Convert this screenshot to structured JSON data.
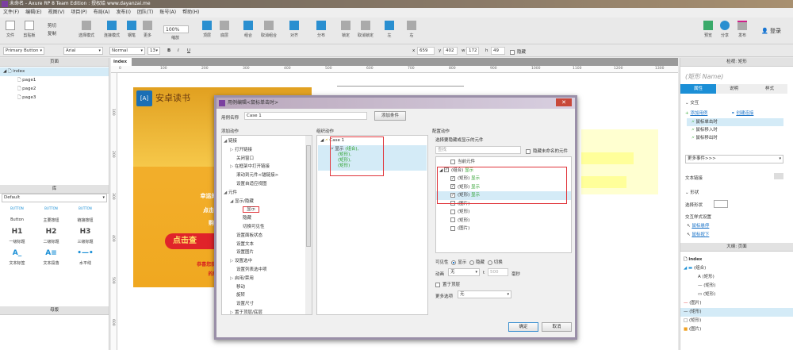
{
  "window": {
    "title": "未命名 - Axure RP 8 Team Edition : 授权给 www.dayanzai.me"
  },
  "menu": [
    "文件(F)",
    "编辑(E)",
    "视图(V)",
    "项目(P)",
    "布局(A)",
    "发布(I)",
    "团队(T)",
    "账号(A)",
    "帮助(H)"
  ],
  "toolbar": {
    "file": "文件",
    "clipboard": "剪贴板",
    "cut": "剪切",
    "copy": "复制",
    "select_mode": "选择模式",
    "connect": "连接模式",
    "pen": "钢笔",
    "more": "更多",
    "zoom": "100%",
    "zoom_label": "缩放",
    "top": "顶层",
    "bottom": "底层",
    "group": "组合",
    "ungroup": "取消组合",
    "align": "对齐",
    "distribute": "分布",
    "lock": "锁定",
    "unlock": "取消锁定",
    "left": "左",
    "right": "右",
    "preview": "预览",
    "share": "分享",
    "publish": "发布",
    "login": "登录"
  },
  "format": {
    "style": "Primary Button",
    "font": "Arial",
    "weight": "Normal",
    "size": "13",
    "bold": "B",
    "italic": "I",
    "underline": "U",
    "x_label": "x",
    "x": "659",
    "y_label": "y",
    "y": "402",
    "w_label": "w",
    "w": "172",
    "h_label": "h",
    "h": "49",
    "hidden": "隐藏"
  },
  "pages": {
    "title": "页面",
    "items": [
      "index",
      "page1",
      "page2",
      "page3"
    ]
  },
  "library": {
    "title": "库",
    "selected": "Default",
    "widgets": [
      {
        "icon": "BUTTON",
        "label": "Button"
      },
      {
        "icon": "BUTTON",
        "label": "主要按钮"
      },
      {
        "icon": "BUTTON",
        "label": "链接按钮"
      },
      {
        "icon": "H1",
        "label": "一级标题"
      },
      {
        "icon": "H2",
        "label": "二级标题"
      },
      {
        "icon": "H3",
        "label": "三级标题"
      },
      {
        "icon": "A_",
        "label": "文本标签"
      },
      {
        "icon": "A≡",
        "label": "文本段落"
      },
      {
        "icon": "•—•",
        "label": "水平线"
      }
    ]
  },
  "masters": {
    "title": "母版"
  },
  "canvas": {
    "tab": "index",
    "hticks": [
      "0",
      "100",
      "200",
      "300",
      "400",
      "500",
      "600",
      "700",
      "800",
      "900",
      "1000",
      "1100",
      "1200",
      "1300"
    ],
    "vticks": [
      "100",
      "200",
      "300",
      "400",
      "500",
      "600"
    ],
    "banner": {
      "logo": "[A]",
      "title": "安卓读书",
      "line1": "幸运的书友你好，",
      "line2": "点击有机会获得",
      "line3": "购买以下书",
      "button": "点击查",
      "red1": "恭喜您获得X元优惠，您",
      "red2": "的所有章节（"
    }
  },
  "dialog": {
    "title": "用例编辑<鼠标单击时>",
    "case_label": "用例名称",
    "case_value": "Case 1",
    "add_condition": "添加条件",
    "add_action": "添加动作",
    "organize": "组织动作",
    "configure": "配置动作",
    "actions": [
      {
        "t": "链接",
        "l": 0,
        "a": "◢"
      },
      {
        "t": "打开链接",
        "l": 1,
        "a": "▷"
      },
      {
        "t": "关闭窗口",
        "l": 1
      },
      {
        "t": "在框架中打开链接",
        "l": 1,
        "a": "▷"
      },
      {
        "t": "滚动到元件<锚链接>",
        "l": 1
      },
      {
        "t": "设置自适应视图",
        "l": 1
      },
      {
        "t": "元件",
        "l": 0,
        "a": "◢"
      },
      {
        "t": "显示/隐藏",
        "l": 1,
        "a": "◢"
      },
      {
        "t": "显示",
        "l": 2
      },
      {
        "t": "隐藏",
        "l": 2
      },
      {
        "t": "切换可见性",
        "l": 2
      },
      {
        "t": "设置面板状态",
        "l": 1
      },
      {
        "t": "设置文本",
        "l": 1
      },
      {
        "t": "设置图片",
        "l": 1
      },
      {
        "t": "设置选中",
        "l": 1,
        "a": "▷"
      },
      {
        "t": "设置列表选中项",
        "l": 1
      },
      {
        "t": "启用/禁用",
        "l": 1,
        "a": "▷"
      },
      {
        "t": "移动",
        "l": 1
      },
      {
        "t": "旋转",
        "l": 1
      },
      {
        "t": "设置尺寸",
        "l": 1
      },
      {
        "t": "置于顶层/底层",
        "l": 1,
        "a": "▷"
      }
    ],
    "case_tree": {
      "case": "Case 1",
      "action": "显示",
      "targets": [
        "(组合),",
        "(矩形),",
        "(矩形),",
        "(矩形)"
      ]
    },
    "select_label": "选择要隐藏或显示的元件",
    "search_placeholder": "查找",
    "hide_unnamed": "隐藏未命名的元件",
    "widgets": [
      {
        "name": "当前元件",
        "checked": false,
        "state": "",
        "l": 1
      },
      {
        "name": "(组合)",
        "checked": true,
        "state": "显示",
        "l": 0
      },
      {
        "name": "(矩形)",
        "checked": true,
        "state": "显示",
        "l": 1
      },
      {
        "name": "(矩形)",
        "checked": true,
        "state": "显示",
        "l": 1
      },
      {
        "name": "(矩形)",
        "checked": true,
        "state": "显示",
        "l": 1,
        "sel": true
      },
      {
        "name": "(图片)",
        "checked": false,
        "state": "",
        "l": 1
      },
      {
        "name": "(矩形)",
        "checked": false,
        "state": "",
        "l": 1
      },
      {
        "name": "(矩形)",
        "checked": false,
        "state": "",
        "l": 1
      },
      {
        "name": "(图片)",
        "checked": false,
        "state": "",
        "l": 1
      }
    ],
    "visibility_label": "可见性",
    "vis_show": "显示",
    "vis_hide": "隐藏",
    "vis_toggle": "切换",
    "animate_label": "动画",
    "animate_value": "无",
    "t_label": "t",
    "t_value": "500",
    "ms": "毫秒",
    "bring_front": "置于顶层",
    "more_label": "更多选项",
    "more_value": "无",
    "ok": "确定",
    "cancel": "取消"
  },
  "inspector": {
    "title": "检视: 矩形",
    "name_placeholder": "(矩形 Name)",
    "tabs": [
      "属性",
      "说明",
      "样式"
    ],
    "interaction": "交互",
    "add_case": "添加用例",
    "create_link": "创建连接",
    "events": [
      "鼠标单击时",
      "鼠标移入时",
      "鼠标移出时"
    ],
    "more_events": "更多事件>>>",
    "text_link": "文本链接",
    "shape": "形状",
    "select_shape": "选择形状",
    "interaction_style": "交互样式设置",
    "hover": "鼠标悬停",
    "mousedown": "鼠标按下"
  },
  "outline": {
    "title": "大纲: 页面",
    "root": "index",
    "items": [
      {
        "icon": "folder",
        "label": "(组合)",
        "l": 0
      },
      {
        "icon": "A",
        "label": "(矩形)",
        "l": 1
      },
      {
        "icon": "—",
        "label": "(矩形)",
        "l": 1
      },
      {
        "icon": "▭",
        "label": "(矩形)",
        "l": 1
      },
      {
        "icon": "red-line",
        "label": "(图片)",
        "l": 0
      },
      {
        "icon": "—",
        "label": "(矩形)",
        "l": 0,
        "sel": true
      },
      {
        "icon": "□",
        "label": "(矩形)",
        "l": 0
      },
      {
        "icon": "img",
        "label": "(图片)",
        "l": 0
      }
    ]
  },
  "colors": {
    "accent": "#1b8fd6",
    "highlight": "#d4ebf7",
    "frame": "#e0353b",
    "show": "#2ca02c"
  }
}
